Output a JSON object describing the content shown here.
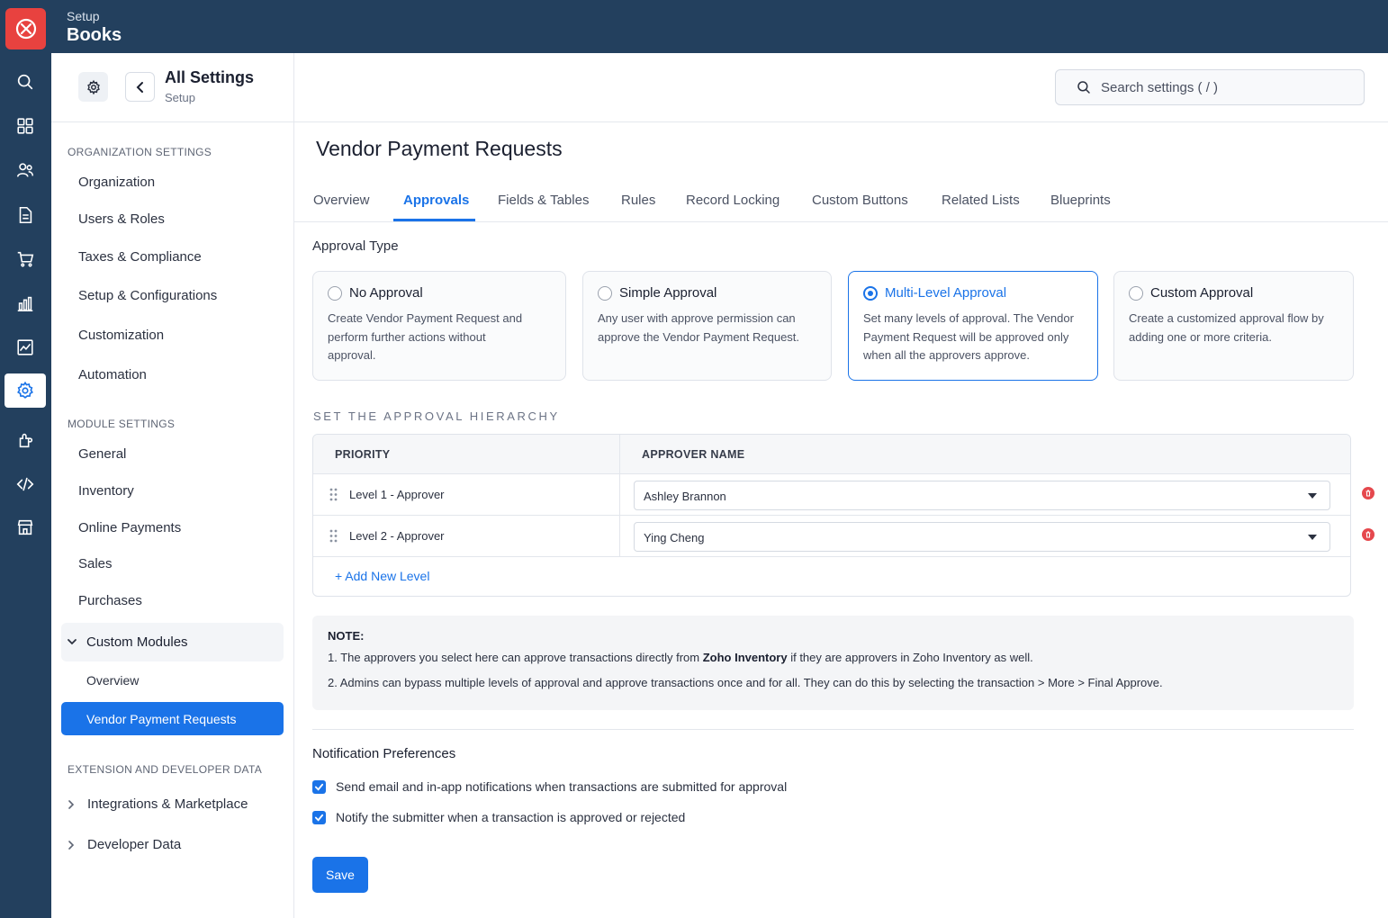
{
  "app": {
    "subtitle": "Setup",
    "title": "Books"
  },
  "rail": {
    "icons": [
      "search-icon",
      "apps-grid-icon",
      "contacts-icon",
      "document-icon",
      "cart-icon",
      "reports-icon",
      "analytics-icon",
      "gear-icon",
      "integrations-icon",
      "code-icon",
      "store-icon"
    ],
    "active": "gear-icon",
    "accent": "#23405e"
  },
  "sidebar": {
    "title": "All Settings",
    "subtitle": "Setup",
    "org_section": "ORGANIZATION SETTINGS",
    "org_items": [
      "Organization",
      "Users & Roles",
      "Taxes & Compliance",
      "Setup & Configurations",
      "Customization",
      "Automation"
    ],
    "module_section": "MODULE SETTINGS",
    "module_items": [
      "General",
      "Inventory",
      "Online Payments",
      "Sales",
      "Purchases"
    ],
    "custom_modules": {
      "label": "Custom Modules",
      "children": [
        "Overview",
        "Vendor Payment Requests"
      ],
      "active": "Vendor Payment Requests"
    },
    "ext_section": "EXTENSION AND DEVELOPER DATA",
    "ext_items": [
      "Integrations & Marketplace",
      "Developer Data"
    ]
  },
  "search": {
    "placeholder": "Search settings ( / )"
  },
  "page": {
    "title": "Vendor Payment Requests",
    "tabs": [
      "Overview",
      "Approvals",
      "Fields & Tables",
      "Rules",
      "Record Locking",
      "Custom Buttons",
      "Related Lists",
      "Blueprints"
    ],
    "active_tab": "Approvals"
  },
  "approval_type": {
    "heading": "Approval Type",
    "options": [
      {
        "title": "No Approval",
        "desc_lines": [
          "Create Vendor Payment Request and",
          "perform further actions without",
          "approval."
        ],
        "selected": false
      },
      {
        "title": "Simple Approval",
        "desc_lines": [
          "Any user with approve permission can",
          "approve the Vendor Payment Request."
        ],
        "selected": false
      },
      {
        "title": "Multi-Level Approval",
        "desc_lines": [
          "Set many levels of approval. The Vendor",
          "Payment Request will be approved only",
          "when all the approvers approve."
        ],
        "selected": true
      },
      {
        "title": "Custom Approval",
        "desc_lines": [
          "Create a customized approval flow by",
          "adding one or more criteria."
        ],
        "selected": false
      }
    ]
  },
  "hierarchy": {
    "heading": "SET THE APPROVAL HIERARCHY",
    "columns": [
      "PRIORITY",
      "APPROVER NAME"
    ],
    "rows": [
      {
        "level": "Level 1 - Approver",
        "approver": "Ashley Brannon"
      },
      {
        "level": "Level 2 - Approver",
        "approver": "Ying Cheng"
      }
    ],
    "add_label": "+ Add New Level"
  },
  "note": {
    "title": "NOTE:",
    "line1_prefix": "1. The approvers you select here can approve transactions directly from ",
    "line1_bold": "Zoho Inventory",
    "line1_suffix": " if they are approvers in Zoho Inventory as well.",
    "line2": "2. Admins can bypass multiple levels of approval and approve transactions once and for all. They can do this by selecting the transaction > More > Final Approve."
  },
  "notifications": {
    "heading": "Notification Preferences",
    "options": [
      {
        "label": "Send email and in-app notifications when transactions are submitted for approval",
        "checked": true
      },
      {
        "label": "Notify the submitter when a transaction is approved or rejected",
        "checked": true
      }
    ]
  },
  "save_label": "Save",
  "colors": {
    "primary": "#1a73e8",
    "topbar": "#23405e",
    "logo": "#e8423f",
    "danger": "#e5484d"
  }
}
